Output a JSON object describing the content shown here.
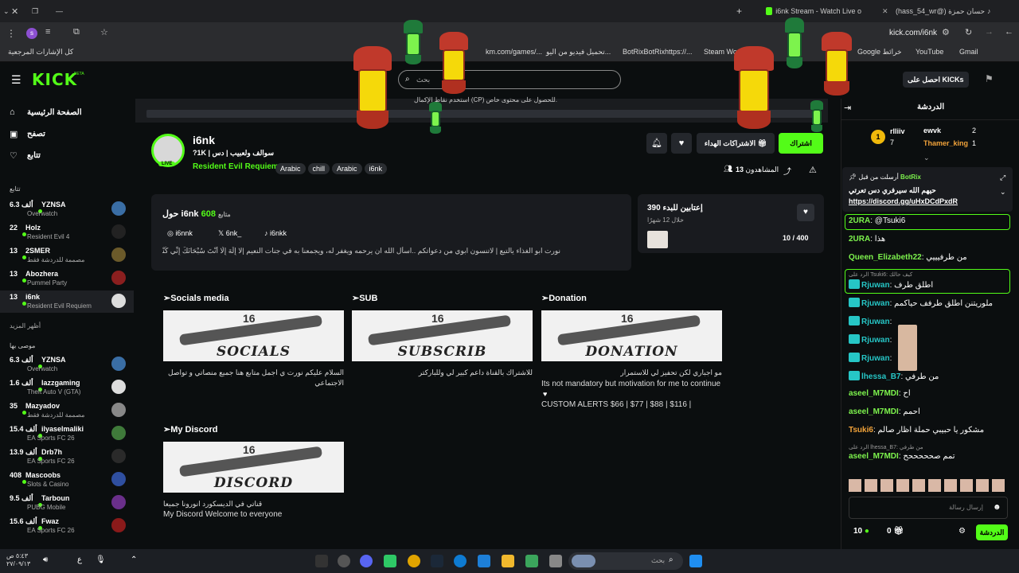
{
  "browser": {
    "tabs": [
      {
        "label": "i6nk Stream - Watch Live o"
      },
      {
        "label": "(hass_54_wr@) حسان حمزة"
      }
    ],
    "url": "kick.com/i6nk",
    "bookmarks": [
      {
        "label": "كل الإشارات المرجعية"
      },
      {
        "label": "Gmail"
      },
      {
        "label": "YouTube"
      },
      {
        "label": "Google خرائط"
      },
      {
        "label": "Steam Worksh"
      },
      {
        "label": "BotRixBotRixhttps://..."
      },
      {
        "label": "تحميل فيديو من اليو..."
      },
      {
        "label": "km.com/games/..."
      }
    ]
  },
  "header": {
    "logo": "KICK",
    "logo_beta": "BETA",
    "search_placeholder": "بحث",
    "get_kicks_label": "احصل على KICKs",
    "cp_notice": "استخدم نقاط الإكمال (CP) للحصول على محتوى خاص."
  },
  "sidebar": {
    "nav": [
      {
        "label": "الصفحة الرئيسية",
        "icon": "home-icon"
      },
      {
        "label": "تصفح",
        "icon": "browse-icon"
      },
      {
        "label": "تتابع",
        "icon": "heart-icon"
      }
    ],
    "following_title": "تتابع",
    "following": [
      {
        "name": "YZNSA",
        "viewers": "6.3 ألف",
        "game": "Overwatch",
        "color": "#3a6ea5"
      },
      {
        "name": "Holz",
        "viewers": "22",
        "game": "Resident Evil 4",
        "color": "#222222"
      },
      {
        "name": "2SMER",
        "viewers": "13",
        "game": "مصممة للدردشة فقط",
        "color": "#6b5a2a"
      },
      {
        "name": "Abozhera",
        "viewers": "13",
        "game": "Pummel Party",
        "color": "#8b1f1f"
      },
      {
        "name": "i6nk",
        "viewers": "13",
        "game": "Resident Evil Requiem",
        "color": "#dddddd"
      }
    ],
    "show_more": "أظهر المزيد",
    "recommended_title": "موصى بها",
    "recommended": [
      {
        "name": "YZNSA",
        "viewers": "6.3 ألف",
        "game": "Overwatch",
        "color": "#3a6ea5"
      },
      {
        "name": "lazzgaming",
        "viewers": "1.6 ألف",
        "game": "Theft Auto V (GTA)",
        "color": "#dddddd"
      },
      {
        "name": "Mazyadov",
        "viewers": "35",
        "game": "مصممة للدردشة فقط",
        "color": "#888888"
      },
      {
        "name": "ilyaselmaliki",
        "viewers": "15.4 ألف",
        "game": "EA Sports FC 26",
        "color": "#3f7a3a"
      },
      {
        "name": "Drb7h",
        "viewers": "13.9 ألف",
        "game": "EA Sports FC 26",
        "color": "#2a2a2a"
      },
      {
        "name": "Mascoobs",
        "viewers": "408",
        "game": "Slots & Casino",
        "color": "#2f4fa0"
      },
      {
        "name": "Tarboun",
        "viewers": "9.5 ألف",
        "game": "PUBG Mobile",
        "color": "#6a2f8a"
      },
      {
        "name": "Fwaz",
        "viewers": "15.6 ألف",
        "game": "EA Sports FC 26",
        "color": "#8a1a1a"
      }
    ]
  },
  "channel": {
    "name": "i6nk",
    "title": "سوالف ولعبيب | دس | 1K?",
    "live_badge": "LIVE",
    "category": "Resident Evil Requiem",
    "tags": [
      "Arabic",
      "chill",
      "Arabic",
      "i6nk"
    ],
    "subscribe_label": "اشتراك",
    "gift_label": "الاشتراكات الهداء",
    "viewers_label": "المشاهدون",
    "viewers": "13"
  },
  "about": {
    "followers_label": "متابع",
    "followers": "608",
    "about_title": "حول i6nk",
    "socials": [
      {
        "label": "i6nnk",
        "icon": "instagram-icon"
      },
      {
        "label": "6nk_",
        "icon": "x-icon"
      },
      {
        "label": "i6nkk",
        "icon": "tiktok-icon"
      }
    ],
    "bio": "نورت ابو الغذاء يالتيع | لاتنسون ابوي من دعواتكم ..اسأل الله ان يرحمه ويغفر له، ويجمعنا به في جنات النعيم |لا إِلَهَ إِلَّا أَنْتَ سُبْحَانَكَ إِنِّي كُنْتُ مِنَ الظَّالِمِينَ |"
  },
  "goal": {
    "title": "إعتابين للبدء 390",
    "subtitle": "خلال 12 شهرًا",
    "progress": "10 / 400",
    "progress_fraction": 0.025
  },
  "panels": [
    {
      "title": "➢Socials media",
      "image_text": "SOCIALS",
      "text": "السلام عليكم نورت ي اجمل متابع هنا جميع منصاتي و تواصل الاجتماعي"
    },
    {
      "title": "➢SUB",
      "image_text": "SUBSCRIB",
      "text": "للاشتراك بالقناة داعم كبير لي وللباركتر"
    },
    {
      "title": "➢Donation",
      "image_text": "DONATION",
      "text": "مو اجباري لكن تحفيز لي للاستمرار",
      "text_en": "Its not mandatory but motivation for me to continue",
      "text_extra": "CUSTOM ALERTS $66 | $77 | $88 | $116 |"
    },
    {
      "title": "➢My Discord",
      "image_text": "DISCORD",
      "text": "قناتي في الديسكورد انورونا جميعا",
      "text_en": "My Discord Welcome to everyone"
    }
  ],
  "chat": {
    "title": "الدردشة",
    "leaderboard": [
      {
        "name": "rlliiv",
        "count": "7"
      },
      {
        "name": "ewvk",
        "count": "2"
      },
      {
        "name": "Thamer_king",
        "count": "1"
      }
    ],
    "pinned_by_label": "أرسلت من قبل",
    "pinned_user": "BotRix",
    "pinned_text": "حيهم الله سيرفري دس تعرتي",
    "pinned_link": "https://discord.gg/uHxDCdPxdR",
    "messages": [
      {
        "user": "2URA",
        "text": "@Tsuki6",
        "color": "#7df34d"
      },
      {
        "user": "2URA",
        "text": "هذا",
        "color": "#7df34d"
      },
      {
        "user": "Queen_Elizabeth22",
        "text": "من طرفيييي",
        "color": "#7df34d"
      },
      {
        "reply": "الرد على Tsuki6: كيف حالك",
        "user": "Rjuwan",
        "text": "اطلق طرف",
        "color": "#26c6c6"
      },
      {
        "user": "Rjuwan",
        "text": "ملوريتنن اطلق طرفف حياكمم",
        "color": "#26c6c6"
      },
      {
        "user": "Rjuwan",
        "text": "",
        "color": "#26c6c6"
      },
      {
        "user": "Rjuwan",
        "text": "",
        "color": "#26c6c6"
      },
      {
        "user": "Rjuwan",
        "text": "",
        "color": "#26c6c6"
      },
      {
        "user": "lhessa_B7",
        "text": "من طرفي",
        "color": "#26c6c6"
      },
      {
        "user": "aseel_M7MDI",
        "text": "اح",
        "color": "#7df34d"
      },
      {
        "user": "aseel_M7MDI",
        "text": "احمم",
        "color": "#7df34d"
      },
      {
        "user": "Tsuki6",
        "text": "مشكور يا حبيبي حملة اظار صالم",
        "color": "#f2a33a"
      },
      {
        "reply": "الرد على lhessa_B7: من طرفي",
        "user": "aseel_M7MDI",
        "text": "تمم صحححححح",
        "color": "#7df34d"
      }
    ],
    "input_placeholder": "إرسال رسالة",
    "chat_button": "الدردشة",
    "points": "10",
    "gifts": "0"
  },
  "taskbar": {
    "search_placeholder": "بحث",
    "time": "٥:٤٣ ص",
    "date": "٢٧/٠٩/١٣"
  }
}
